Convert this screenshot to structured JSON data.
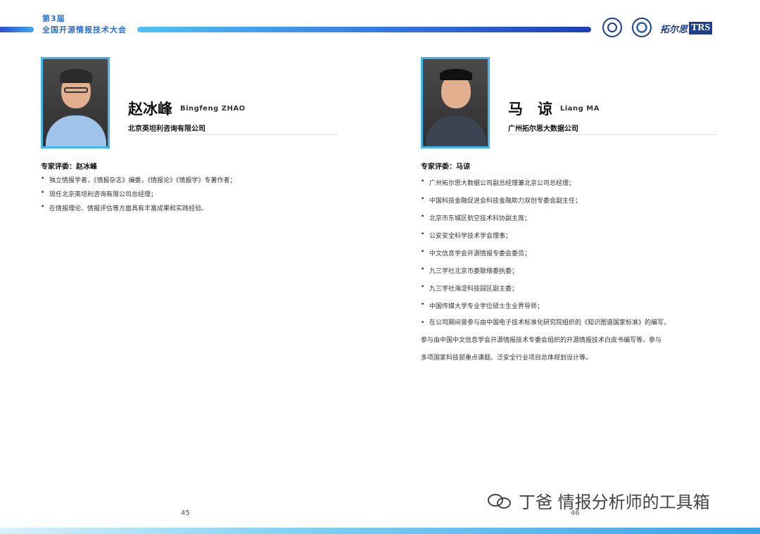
{
  "header": {
    "edition": "第3届",
    "conference": "全国开源情报技术大会",
    "logo_left_name": "university-seal-logo",
    "logo_mid_name": "institute-emblem-logo",
    "logo_trs_cn": "拓尔思",
    "logo_trs_en": "TRS"
  },
  "left": {
    "name_cn": "赵冰峰",
    "name_en": "Bingfeng ZHAO",
    "company": "北京英坦利咨询有限公司",
    "reviewer": "专家评委：赵冰峰",
    "bullets": [
      "独立情报学者，《情报杂志》编委，《情报论》《情报学》专著作者；",
      "现任北京英坦利咨询有限公司总经理；",
      "在情报理论、情报评估等方面具有丰富成果和实践经验。"
    ],
    "page": "45"
  },
  "right": {
    "name_cn": "马　谅",
    "name_en": "Liang MA",
    "company": "广州拓尔思大数据公司",
    "reviewer": "专家评委：马谅",
    "bullets": [
      "广州拓尔思大数据公司副总经理兼北京公司总经理；",
      "中国科技金融促进会科技金融助力双创专委会副主任；",
      "北京市东城区航空技术科协副主席；",
      "公安安全科学技术学会理事；",
      "中文信息学会开源情报专委会委员；",
      "九三学社北京市委联络委执委；",
      "九三学社海淀科技园区副主委；",
      "中国传媒大学专业学位硕士生业界导师；"
    ],
    "long_bullet_lines": [
      "在公司期间曾参与由中国电子技术标准化研究院组织的《知识图谱国家标准》的编写，",
      "参与由中国中文信息学会开源情报技术专委会组织的开源情报技术白皮书编写等，参与",
      "多项国家科技部重点课题、泛安全行业项目总体规划设计等。"
    ],
    "page": "46"
  },
  "watermark": {
    "text": "丁爸 情报分析师的工具箱",
    "icon": "wechat-icon"
  }
}
